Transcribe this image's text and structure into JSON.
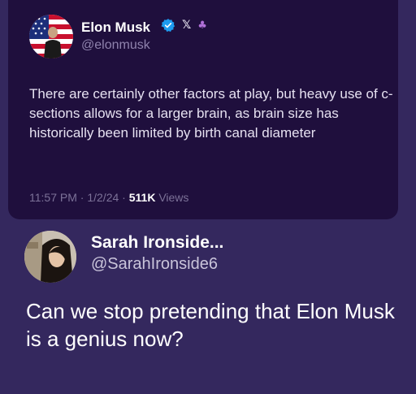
{
  "quoted_post": {
    "author_name": "Elon Musk",
    "author_handle": "@elonmusk",
    "badges": [
      "verified-icon",
      "x-icon",
      "affiliate-icon"
    ],
    "body": "There are certainly other factors at play, but heavy use of c-sections allows for a larger brain, as brain size has historically been limited by birth canal diameter",
    "time": "11:57 PM",
    "date": "1/2/24",
    "views_count": "511K",
    "views_label": "Views"
  },
  "reply_post": {
    "author_name": "Sarah Ironside...",
    "author_handle": "@SarahIronside6",
    "body": "Can we stop pretending that Elon Musk is a genius now?"
  },
  "colors": {
    "background": "#34285e",
    "card_background": "#1f0f3d",
    "verified_blue": "#1d9bf0",
    "muted_text": "#8f83ad"
  }
}
